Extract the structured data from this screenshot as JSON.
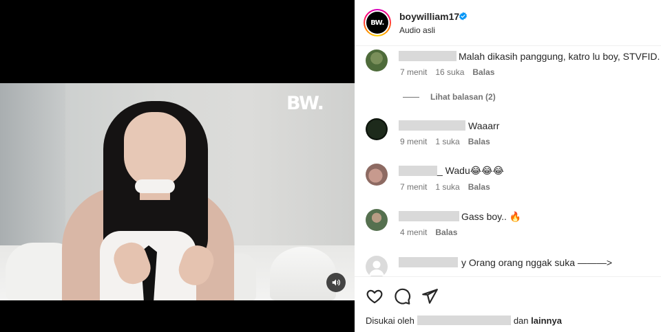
{
  "video": {
    "watermark": "BW.",
    "mute_icon": "speaker-icon"
  },
  "post": {
    "account_logo": "BW.",
    "username": "boywilliam17",
    "verified_icon": "verified-badge-icon",
    "audio": "Audio asli"
  },
  "comments": [
    {
      "text": "Malah dikasih panggung, katro lu boy, STVFID.",
      "time": "7 menit",
      "likes": "16 suka",
      "reply": "Balas",
      "view_replies": "Lihat balasan (2)"
    },
    {
      "text": "Waaarr",
      "time": "9 menit",
      "likes": "1 suka",
      "reply": "Balas"
    },
    {
      "text": "_ Wadu😂😂😂",
      "time": "7 menit",
      "likes": "1 suka",
      "reply": "Balas"
    },
    {
      "text": "Gass boy.. 🔥",
      "time": "4 menit",
      "reply": "Balas"
    },
    {
      "text": "y Orang orang nggak suka ———>"
    }
  ],
  "actions": {
    "like_icon": "heart-icon",
    "comment_icon": "comment-icon",
    "share_icon": "send-icon"
  },
  "liked_by": {
    "prefix": "Disukai oleh",
    "middle": "dan",
    "others": "lainnya"
  },
  "colors": {
    "text": "#262626",
    "muted": "#737373",
    "verified": "#0095f6",
    "border": "#efefef"
  }
}
